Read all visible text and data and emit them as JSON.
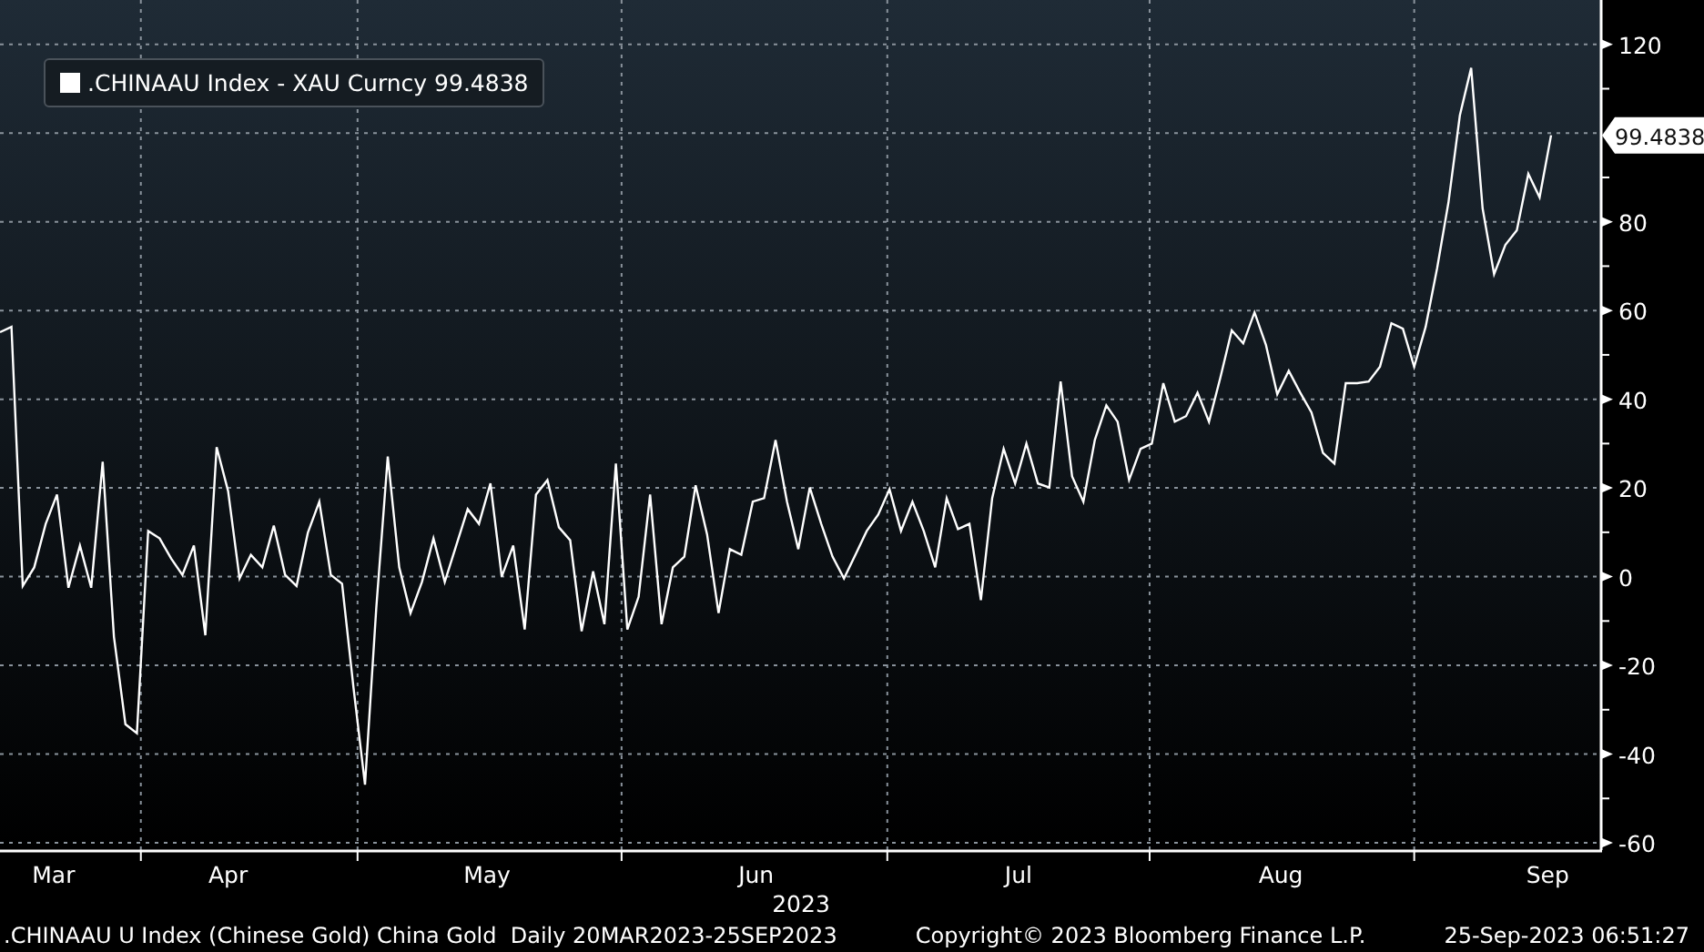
{
  "legend": {
    "value": "99.4838"
  },
  "x_axis": {
    "months": [
      "Mar",
      "Apr",
      "May",
      "Jun",
      "Jul",
      "Aug",
      "Sep"
    ]
  },
  "chart_data": {
    "type": "line",
    "xlabel": "2023",
    "ylim": [
      -60,
      130
    ],
    "grid": true,
    "yticks": [
      -60,
      -40,
      -20,
      0,
      20,
      40,
      60,
      80,
      120
    ],
    "series": [
      {
        "name": ".CHINAAU Index - XAU Curncy",
        "color": "#ffffff",
        "values": [
          55.1,
          56.3,
          -2.1,
          2.1,
          11.9,
          18.5,
          -2.5,
          7.0,
          -2.5,
          25.9,
          -13.6,
          -33.3,
          -35.3,
          10.3,
          8.6,
          4.1,
          0.4,
          7.0,
          -13.2,
          29.2,
          19.3,
          -0.4,
          4.9,
          2.1,
          11.5,
          0.4,
          -2.1,
          9.9,
          16.9,
          0.4,
          -1.6,
          -25.1,
          -46.9,
          -7.0,
          27.1,
          2.1,
          -8.2,
          -1.2,
          8.6,
          -1.2,
          7.0,
          15.2,
          11.9,
          21.0,
          0,
          7.0,
          -11.9,
          18.5,
          21.8,
          11.1,
          8.2,
          -12.3,
          1.2,
          -10.7,
          25.5,
          -11.9,
          -4.5,
          18.5,
          -10.7,
          2.1,
          4.5,
          20.6,
          9.5,
          -8.2,
          6.2,
          4.9,
          16.9,
          17.7,
          30.8,
          16.9,
          6.2,
          20.1,
          11.9,
          4.5,
          -0.4,
          4.9,
          10.3,
          14.0,
          19.7,
          10.3,
          16.9,
          10.3,
          2.1,
          17.7,
          10.7,
          11.9,
          -5.3,
          17.7,
          28.8,
          21.0,
          30.0,
          21.0,
          20.1,
          44.0,
          22.6,
          16.9,
          30.8,
          38.6,
          34.9,
          21.8,
          28.8,
          30.0,
          43.6,
          34.9,
          36.2,
          41.5,
          34.9,
          44.8,
          55.5,
          52.6,
          59.6,
          52.2,
          41.1,
          46.4,
          41.5,
          37.0,
          27.9,
          25.5,
          43.6,
          43.6,
          44.0,
          47.3,
          57.1,
          55.9,
          47.3,
          56.3,
          69.5,
          84.3,
          104.0,
          114.7,
          83.0,
          68.2,
          74.8,
          78.1,
          90.8,
          85.5,
          99.5
        ]
      }
    ]
  },
  "last_value_label": "99.4838",
  "footer": {
    "description": ".CHINAAU U Index (Chinese Gold) China Gold  Daily 20MAR2023-25SEP2023",
    "copyright": "Copyright© 2023 Bloomberg Finance L.P.",
    "timestamp": "25-Sep-2023 06:51:27"
  }
}
